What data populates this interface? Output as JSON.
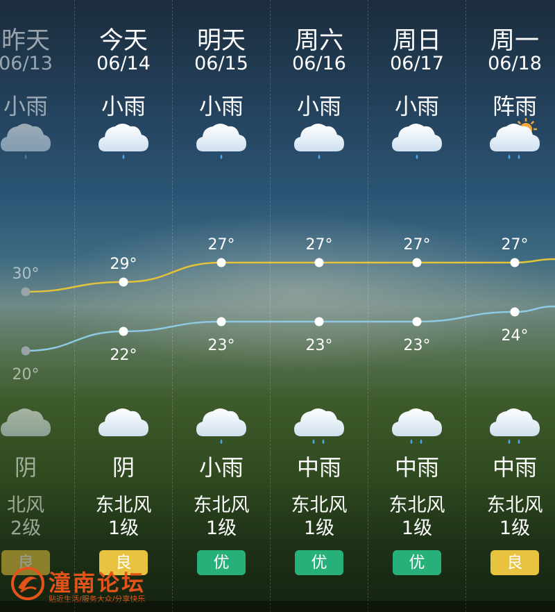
{
  "days": [
    {
      "name": "昨天",
      "date": "06/13",
      "day_weather": "小雨",
      "day_icon": "light-rain-icon",
      "night_weather": "阴",
      "night_icon": "cloudy-icon",
      "wind": "北风",
      "wind_level": "2级",
      "aqi": "良",
      "aqi_color": "#e8c33f",
      "high": 30,
      "low": 20,
      "past": true
    },
    {
      "name": "今天",
      "date": "06/14",
      "day_weather": "小雨",
      "day_icon": "light-rain-icon",
      "night_weather": "阴",
      "night_icon": "cloudy-icon",
      "wind": "东北风",
      "wind_level": "1级",
      "aqi": "良",
      "aqi_color": "#e8c33f",
      "high": 29,
      "low": 22,
      "past": false
    },
    {
      "name": "明天",
      "date": "06/15",
      "day_weather": "小雨",
      "day_icon": "light-rain-icon",
      "night_weather": "小雨",
      "night_icon": "light-rain-icon",
      "wind": "东北风",
      "wind_level": "1级",
      "aqi": "优",
      "aqi_color": "#27b07a",
      "high": 27,
      "low": 23,
      "past": false
    },
    {
      "name": "周六",
      "date": "06/16",
      "day_weather": "小雨",
      "day_icon": "light-rain-icon",
      "night_weather": "中雨",
      "night_icon": "moderate-rain-icon",
      "wind": "东北风",
      "wind_level": "1级",
      "aqi": "优",
      "aqi_color": "#27b07a",
      "high": 27,
      "low": 23,
      "past": false
    },
    {
      "name": "周日",
      "date": "06/17",
      "day_weather": "小雨",
      "day_icon": "light-rain-icon",
      "night_weather": "中雨",
      "night_icon": "moderate-rain-icon",
      "wind": "东北风",
      "wind_level": "1级",
      "aqi": "优",
      "aqi_color": "#27b07a",
      "high": 27,
      "low": 23,
      "past": false
    },
    {
      "name": "周一",
      "date": "06/18",
      "day_weather": "阵雨",
      "day_icon": "shower-sun-icon",
      "night_weather": "中雨",
      "night_icon": "moderate-rain-icon",
      "wind": "东北风",
      "wind_level": "1级",
      "aqi": "良",
      "aqi_color": "#e8c33f",
      "high": 27,
      "low": 24,
      "past": false
    }
  ],
  "colors": {
    "high_line": "#e3c33a",
    "low_line": "#8ccbe3"
  },
  "watermark": {
    "title": "潼南论坛",
    "subtitle": "贴近生活/服务大众/分享快乐"
  }
}
